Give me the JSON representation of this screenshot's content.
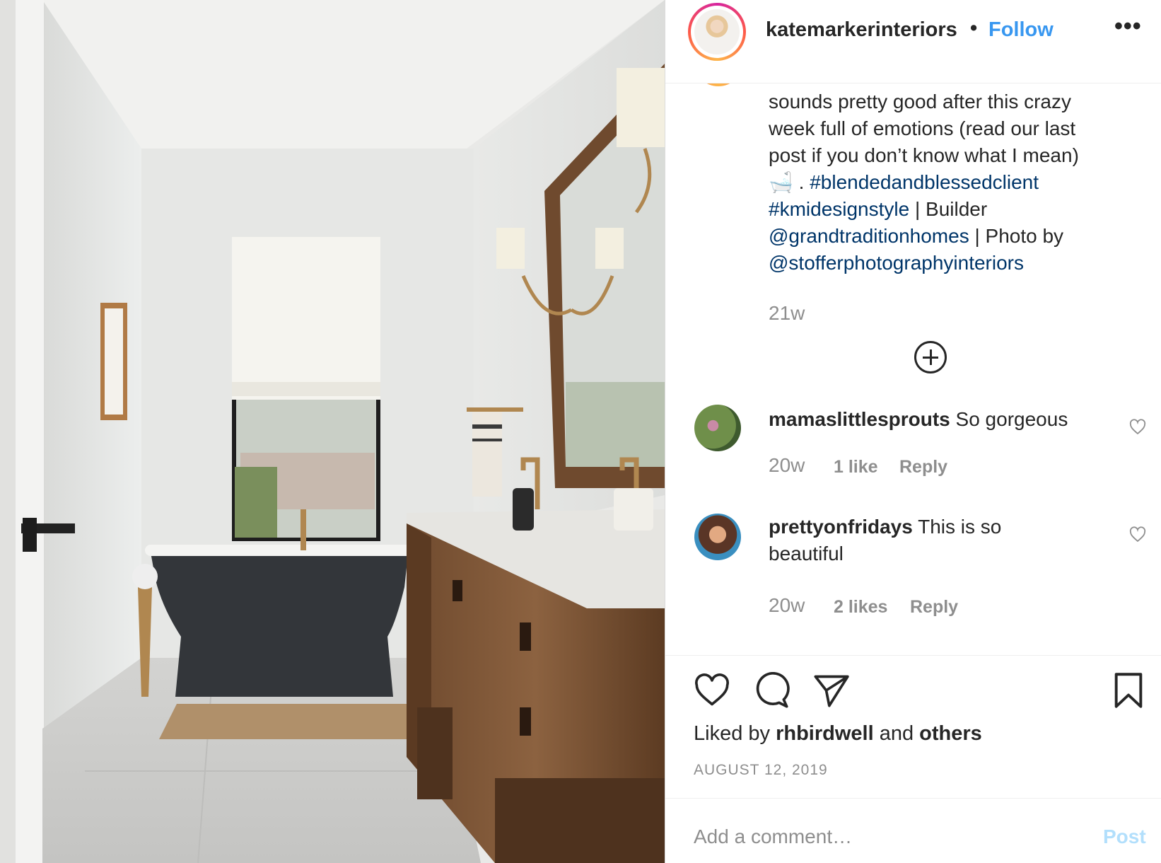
{
  "post": {
    "username": "katemarkerinteriors",
    "separator": "•",
    "follow_label": "Follow",
    "more_label": "•••",
    "caption": {
      "line1": "sounds pretty good after this crazy",
      "line2": "week full of emotions (read our last",
      "line3": "post if you don’t know what I mean)",
      "emoji": "🛁",
      "dot": " . ",
      "tag1": "#blendedandblessedclient",
      "tag2": "#kmidesignstyle",
      "builder_text": " | Builder",
      "mention1": "@grandtraditionhomes",
      "photo_text": " | Photo by",
      "mention2": "@stofferphotographyinteriors"
    },
    "caption_time": "21w"
  },
  "comments": [
    {
      "username": "mamaslittlesprouts",
      "text": " So gorgeous",
      "time": "20w",
      "likes": "1 like",
      "reply": "Reply"
    },
    {
      "username": "prettyonfridays",
      "text": " This is so beautiful",
      "time": "20w",
      "likes": "2 likes",
      "reply": "Reply"
    }
  ],
  "likes": {
    "prefix": "Liked by ",
    "user": "rhbirdwell",
    "mid": " and ",
    "others": "others"
  },
  "date": "AUGUST 12, 2019",
  "comment_input": {
    "placeholder": "Add a comment…",
    "post_label": "Post"
  },
  "icons": {
    "like": "heart-icon",
    "comment": "comment-bubble-icon",
    "share": "share-paper-plane-icon",
    "save": "bookmark-icon",
    "load_more": "plus-circle-icon"
  },
  "colors": {
    "link": "#3897f0",
    "hashtag": "#003569",
    "muted": "#8e8e8e",
    "post_disabled": "#b2dffc"
  }
}
